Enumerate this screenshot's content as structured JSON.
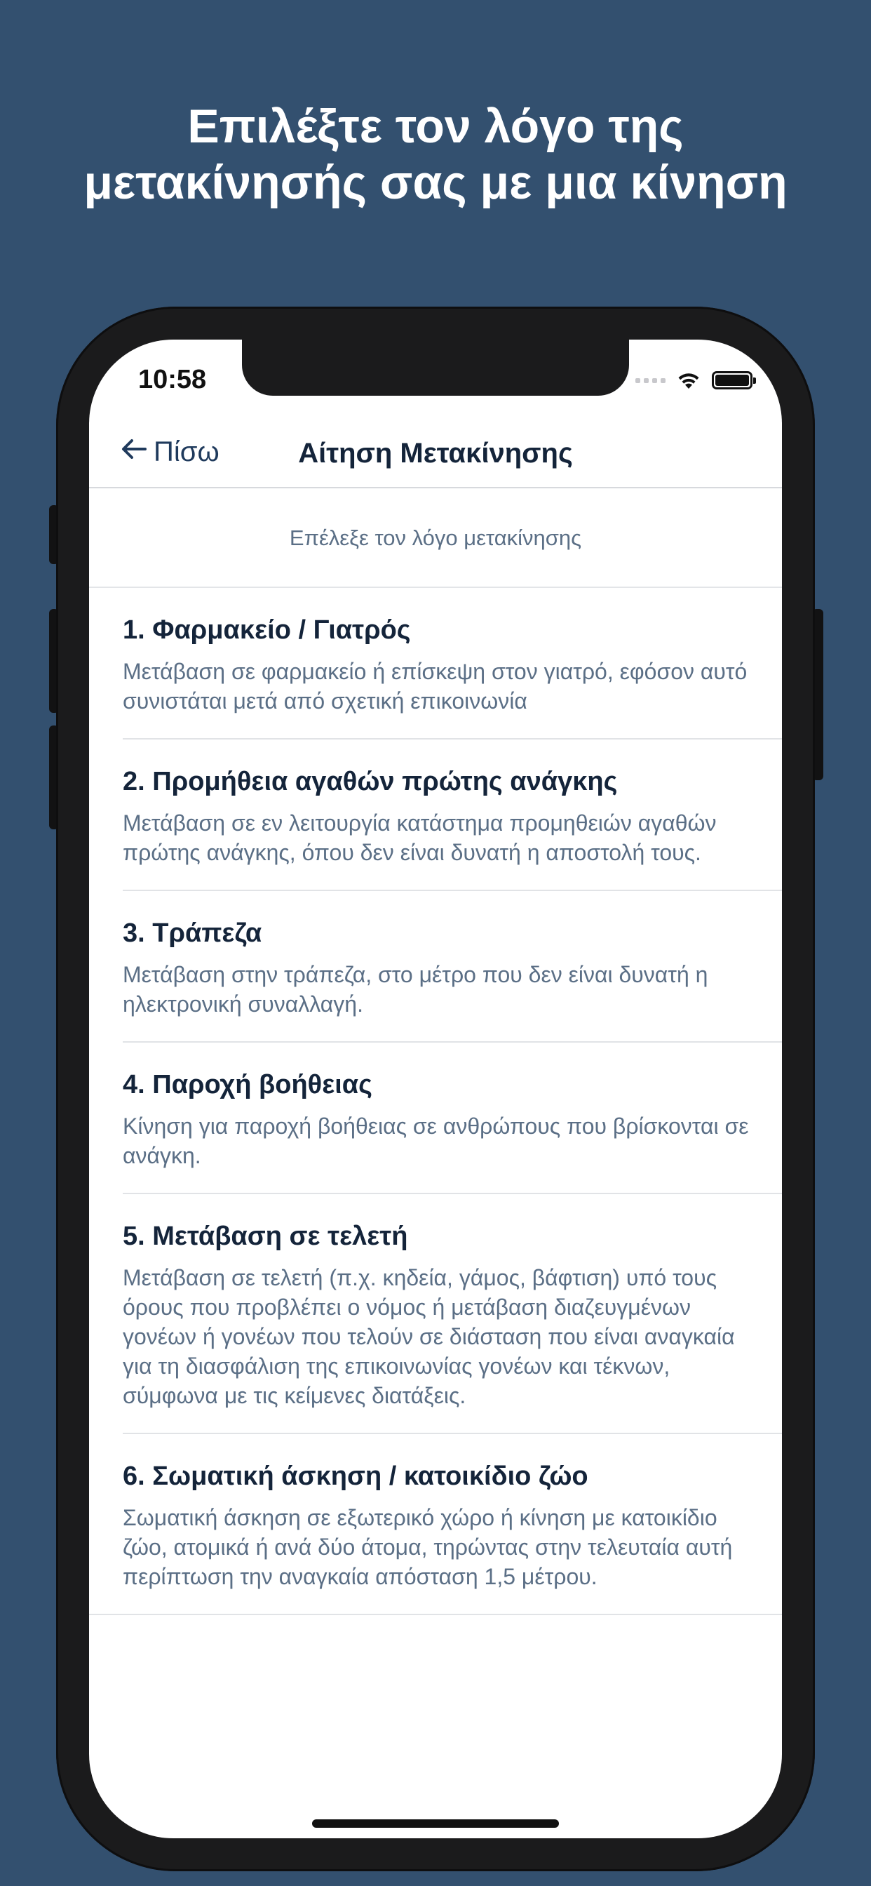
{
  "promo": {
    "headline_line1": "Επιλέξτε τον λόγο της",
    "headline_line2": "μετακίνησής σας με μια κίνηση"
  },
  "status_bar": {
    "time": "10:58",
    "icons": [
      "cellular-signal-icon",
      "wifi-icon",
      "battery-icon"
    ]
  },
  "nav": {
    "back_label": "Πίσω",
    "title": "Αίτηση Μετακίνησης"
  },
  "prompt": "Επέλεξε τον λόγο μετακίνησης",
  "reasons": [
    {
      "title": "1. Φαρμακείο / Γιατρός",
      "desc": "Μετάβαση σε φαρμακείο ή επίσκεψη στον γιατρό, εφόσον αυτό συνιστάται μετά από σχετική επικοινωνία"
    },
    {
      "title": "2. Προμήθεια αγαθών πρώτης ανάγκης",
      "desc": "Μετάβαση σε εν λειτουργία κατάστημα προμηθειών αγαθών πρώτης ανάγκης, όπου δεν είναι δυνατή η αποστολή τους."
    },
    {
      "title": "3. Τράπεζα",
      "desc": "Μετάβαση στην τράπεζα, στο μέτρο που δεν είναι δυνατή η ηλεκτρονική συναλλαγή."
    },
    {
      "title": "4. Παροχή βοήθειας",
      "desc": "Κίνηση για παροχή βοήθειας σε ανθρώπους που βρίσκονται σε ανάγκη."
    },
    {
      "title": "5. Μετάβαση σε τελετή",
      "desc": "Μετάβαση σε τελετή (π.χ. κηδεία, γάμος, βάφτιση) υπό τους όρους που προβλέπει ο νόμος ή μετάβαση διαζευγμένων γονέων ή γονέων που τελούν σε διάσταση που είναι αναγκαία για τη διασφάλιση της επικοινωνίας γονέων και τέκνων, σύμφωνα με τις κείμενες διατάξεις."
    },
    {
      "title": "6. Σωματική άσκηση / κατοικίδιο ζώο",
      "desc": "Σωματική άσκηση σε εξωτερικό χώρο ή κίνηση με κατοικίδιο ζώο, ατομικά ή ανά δύο άτομα, τηρώντας στην τελευταία αυτή περίπτωση την αναγκαία απόσταση 1,5 μέτρου."
    }
  ],
  "colors": {
    "background": "#33506f",
    "title_text": "#14243a",
    "body_text": "#5b6f86"
  }
}
